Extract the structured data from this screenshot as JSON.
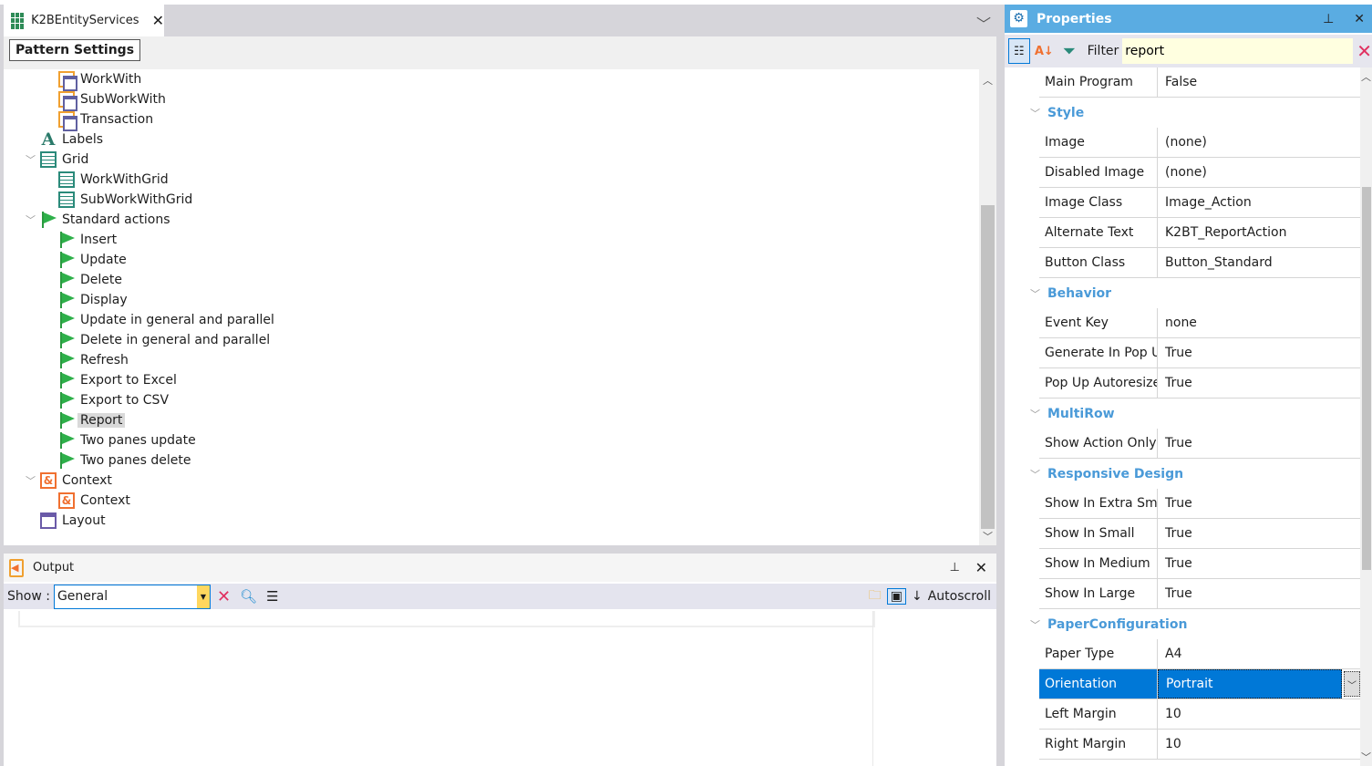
{
  "editor": {
    "tab_title": "K2BEntityServices",
    "pattern_settings_label": "Pattern Settings",
    "tree": [
      {
        "label": "WorkWith",
        "icon": "window-icon",
        "level": 2
      },
      {
        "label": "SubWorkWith",
        "icon": "window-icon",
        "level": 2
      },
      {
        "label": "Transaction",
        "icon": "window-icon",
        "level": 2
      },
      {
        "label": "Labels",
        "icon": "labels-icon",
        "level": 1
      },
      {
        "label": "Grid",
        "icon": "grid-icon",
        "level": 1,
        "expanded": true
      },
      {
        "label": "WorkWithGrid",
        "icon": "grid-icon",
        "level": 2
      },
      {
        "label": "SubWorkWithGrid",
        "icon": "grid-icon",
        "level": 2
      },
      {
        "label": "Standard actions",
        "icon": "flag-icon",
        "level": 1,
        "expanded": true
      },
      {
        "label": "Insert",
        "icon": "flag-icon",
        "level": 2
      },
      {
        "label": "Update",
        "icon": "flag-icon",
        "level": 2
      },
      {
        "label": "Delete",
        "icon": "flag-icon",
        "level": 2
      },
      {
        "label": "Display",
        "icon": "flag-icon",
        "level": 2
      },
      {
        "label": "Update in general and parallel",
        "icon": "flag-icon",
        "level": 2
      },
      {
        "label": "Delete in general and parallel",
        "icon": "flag-icon",
        "level": 2
      },
      {
        "label": "Refresh",
        "icon": "flag-icon",
        "level": 2
      },
      {
        "label": "Export to Excel",
        "icon": "flag-icon",
        "level": 2
      },
      {
        "label": "Export to CSV",
        "icon": "flag-icon",
        "level": 2
      },
      {
        "label": "Report",
        "icon": "flag-icon",
        "level": 2,
        "selected": true
      },
      {
        "label": "Two panes update",
        "icon": "flag-icon",
        "level": 2
      },
      {
        "label": "Two panes delete",
        "icon": "flag-icon",
        "level": 2
      },
      {
        "label": "Context",
        "icon": "context-icon",
        "level": 1,
        "expanded": true
      },
      {
        "label": "Context",
        "icon": "context-icon",
        "level": 2
      },
      {
        "label": "Layout",
        "icon": "layout-icon",
        "level": 1
      }
    ]
  },
  "output": {
    "title": "Output",
    "show_label": "Show :",
    "show_value": "General",
    "autoscroll_label": "Autoscroll"
  },
  "properties": {
    "title": "Properties",
    "filter_label": "Filter",
    "filter_value": "report",
    "rows": [
      {
        "type": "prop",
        "key": "Main Program",
        "value": "False"
      },
      {
        "type": "cat",
        "key": "Style"
      },
      {
        "type": "prop",
        "key": "Image",
        "value": "(none)"
      },
      {
        "type": "prop",
        "key": "Disabled Image",
        "value": "(none)"
      },
      {
        "type": "prop",
        "key": "Image Class",
        "value": "Image_Action"
      },
      {
        "type": "prop",
        "key": "Alternate Text",
        "value": "K2BT_ReportAction"
      },
      {
        "type": "prop",
        "key": "Button Class",
        "value": "Button_Standard"
      },
      {
        "type": "cat",
        "key": "Behavior"
      },
      {
        "type": "prop",
        "key": "Event Key",
        "value": "none"
      },
      {
        "type": "prop",
        "key": "Generate In Pop Up",
        "value": "True"
      },
      {
        "type": "prop",
        "key": "Pop Up Autoresize",
        "value": "True"
      },
      {
        "type": "cat",
        "key": "MultiRow"
      },
      {
        "type": "prop",
        "key": "Show Action Only",
        "value": "True"
      },
      {
        "type": "cat",
        "key": "Responsive Design"
      },
      {
        "type": "prop",
        "key": "Show In Extra Small",
        "value": "True"
      },
      {
        "type": "prop",
        "key": "Show In Small",
        "value": "True"
      },
      {
        "type": "prop",
        "key": "Show In Medium",
        "value": "True"
      },
      {
        "type": "prop",
        "key": "Show In Large",
        "value": "True"
      },
      {
        "type": "cat",
        "key": "PaperConfiguration"
      },
      {
        "type": "prop",
        "key": "Paper Type",
        "value": "A4"
      },
      {
        "type": "prop",
        "key": "Orientation",
        "value": "Portrait",
        "selected": true
      },
      {
        "type": "prop",
        "key": "Left Margin",
        "value": "10"
      },
      {
        "type": "prop",
        "key": "Right Margin",
        "value": "10"
      }
    ]
  }
}
